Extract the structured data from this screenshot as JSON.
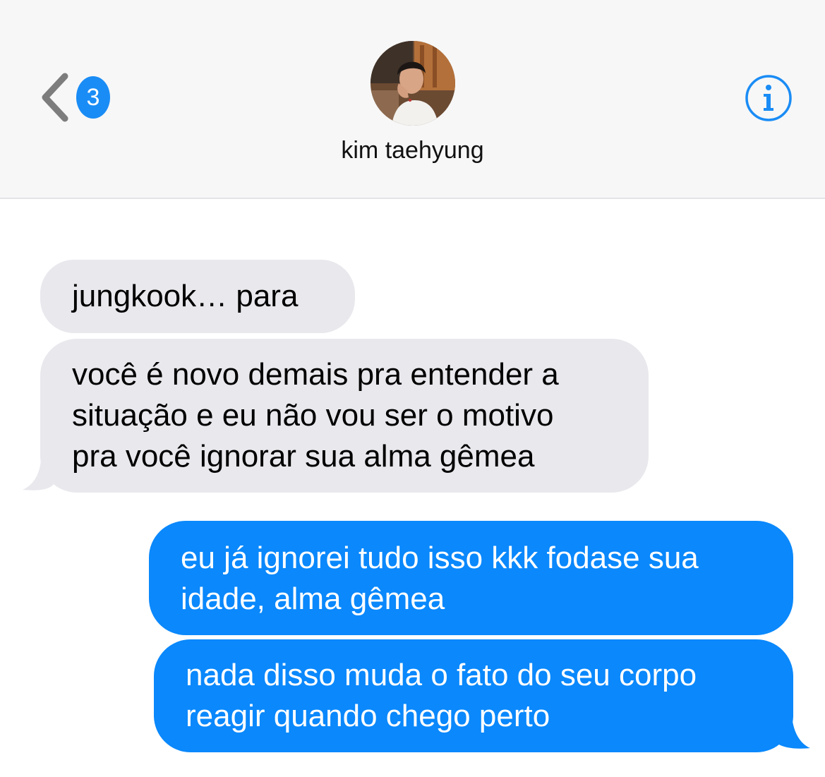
{
  "header": {
    "back_badge_count": "3",
    "contact_name": "kim taehyung",
    "avatar_alt": "kim taehyung",
    "icons": {
      "back": "chevron-left-icon",
      "info": "info-icon"
    }
  },
  "colors": {
    "accent": "#1a8cf5",
    "sent_bubble": "#0a88fc",
    "received_bubble": "#e9e8ed",
    "header_background": "#f7f7f7"
  },
  "messages": [
    {
      "direction": "received",
      "text": "jungkook… para"
    },
    {
      "direction": "received",
      "text": "você é novo demais pra entender a\nsituação e eu não vou ser o motivo\npra você ignorar sua alma gêmea"
    },
    {
      "direction": "sent",
      "text": "eu já ignorei tudo isso kkk fodase sua\nidade, alma gêmea"
    },
    {
      "direction": "sent",
      "text": "nada disso muda o fato do seu corpo\nreagir quando chego perto"
    }
  ]
}
